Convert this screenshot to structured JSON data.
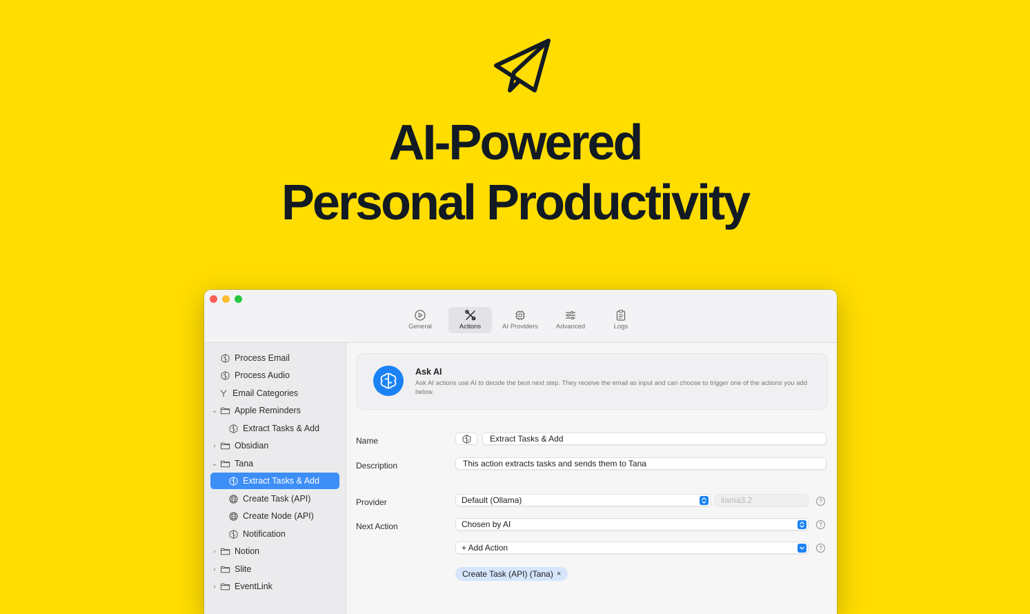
{
  "hero": {
    "logo_icon": "paper-plane-icon",
    "title_line1": "AI-Powered",
    "title_line2": "Personal Productivity",
    "background": "#FFDD00"
  },
  "toolbar": {
    "tabs": [
      {
        "label": "General",
        "icon": "play-circle-icon",
        "active": false
      },
      {
        "label": "Actions",
        "icon": "tools-icon",
        "active": true
      },
      {
        "label": "AI Providers",
        "icon": "chip-icon",
        "active": false
      },
      {
        "label": "Advanced",
        "icon": "sliders-icon",
        "active": false
      },
      {
        "label": "Logs",
        "icon": "clipboard-icon",
        "active": false
      }
    ]
  },
  "sidebar": {
    "items": [
      {
        "label": "Process Email",
        "icon": "brain-icon"
      },
      {
        "label": "Process Audio",
        "icon": "brain-icon"
      },
      {
        "label": "Email Categories",
        "icon": "split-icon"
      },
      {
        "label": "Apple Reminders",
        "icon": "folder-icon",
        "expanded": true
      },
      {
        "label": "Extract Tasks & Add",
        "icon": "brain-icon"
      },
      {
        "label": "Obsidian",
        "icon": "folder-icon",
        "expanded": false
      },
      {
        "label": "Tana",
        "icon": "folder-icon",
        "expanded": true
      },
      {
        "label": "Extract Tasks & Add",
        "icon": "brain-icon",
        "selected": true
      },
      {
        "label": "Create Task (API)",
        "icon": "globe-icon"
      },
      {
        "label": "Create Node (API)",
        "icon": "globe-icon"
      },
      {
        "label": "Notification",
        "icon": "brain-icon"
      },
      {
        "label": "Notion",
        "icon": "folder-icon",
        "expanded": false
      },
      {
        "label": "Slite",
        "icon": "folder-icon",
        "expanded": false
      },
      {
        "label": "EventLink",
        "icon": "folder-icon",
        "expanded": false
      }
    ]
  },
  "info": {
    "title": "Ask AI",
    "description": "Ask AI actions use AI to decide the best next step. They receive the email as input and can choose to trigger one of the actions you add below."
  },
  "form": {
    "name_label": "Name",
    "name_value": "Extract Tasks & Add",
    "description_label": "Description",
    "description_value": "This action extracts tasks and sends them to Tana",
    "provider_label": "Provider",
    "provider_value": "Default (Ollama)",
    "model_placeholder": "llama3.2",
    "next_action_label": "Next Action",
    "next_action_value": "Chosen by AI",
    "add_action_label": "+ Add Action",
    "chip_label": "Create Task (API) (Tana)",
    "chip_remove": "×",
    "help_glyph": "?"
  },
  "colors": {
    "accent": "#1a82f4",
    "selection": "#3d8ef7",
    "chip": "#d6e5fb"
  }
}
